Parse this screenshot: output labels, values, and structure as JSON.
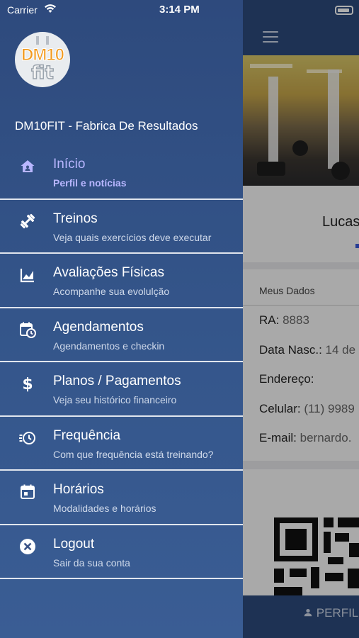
{
  "status_bar": {
    "carrier": "Carrier",
    "time": "3:14 PM"
  },
  "drawer": {
    "gym_name": "DM10FIT - Fabrica De Resultados",
    "logo": {
      "top_text": "DM10",
      "bottom_text": "fit"
    },
    "items": [
      {
        "icon": "home-icon",
        "label": "Início",
        "subtitle": "Perfil e notícias",
        "active": true
      },
      {
        "icon": "dumbbell-icon",
        "label": "Treinos",
        "subtitle": "Veja quais exercícios deve executar",
        "active": false
      },
      {
        "icon": "chart-icon",
        "label": "Avaliações Físicas",
        "subtitle": "Acompanhe sua evolulção",
        "active": false
      },
      {
        "icon": "calendar-clock-icon",
        "label": "Agendamentos",
        "subtitle": "Agendamentos e checkin",
        "active": false
      },
      {
        "icon": "dollar-icon",
        "label": "Planos / Pagamentos",
        "subtitle": "Veja seu histórico financeiro",
        "active": false
      },
      {
        "icon": "history-icon",
        "label": "Frequência",
        "subtitle": "Com que frequência está treinando?",
        "active": false
      },
      {
        "icon": "calendar-icon",
        "label": "Horários",
        "subtitle": "Modalidades e horários",
        "active": false
      },
      {
        "icon": "logout-icon",
        "label": "Logout",
        "subtitle": "Sair da sua conta",
        "active": false
      }
    ]
  },
  "background": {
    "profile_name": "Lucas",
    "data_title": "Meus Dados",
    "fields": [
      {
        "label": "RA:",
        "value": "8883"
      },
      {
        "label": "Data Nasc.:",
        "value": "14 de"
      },
      {
        "label": "Endereço:",
        "value": ""
      },
      {
        "label": "Celular:",
        "value": "(11) 9989"
      },
      {
        "label": "E-mail:",
        "value": "bernardo."
      }
    ],
    "bottom_tab": "PERFIL"
  },
  "colors": {
    "drawer": "#2e4a7d",
    "active": "#b8b6ff",
    "header": "#2d4a7c"
  }
}
